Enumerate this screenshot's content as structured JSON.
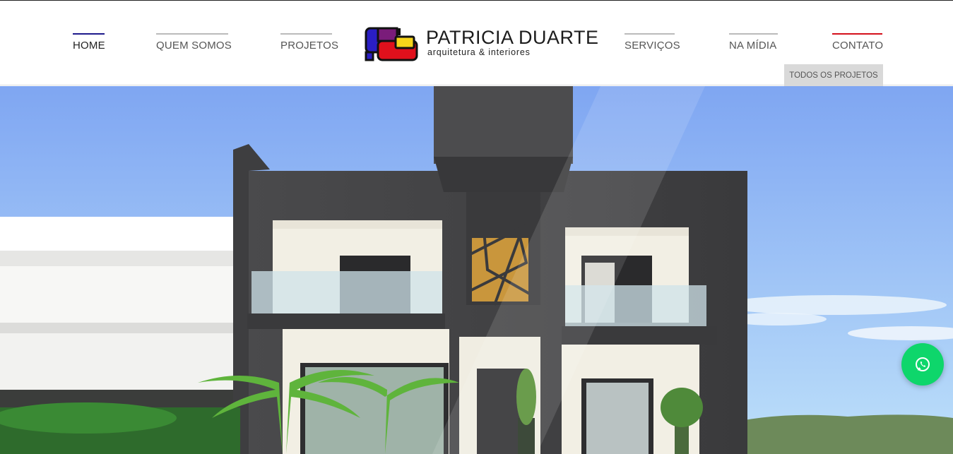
{
  "nav": {
    "left": [
      {
        "label": "HOME",
        "active": true,
        "bar_color": "#1e1a8c"
      },
      {
        "label": "QUEM SOMOS",
        "active": false,
        "bar_color": "#b5b5b5"
      },
      {
        "label": "PROJETOS",
        "active": false,
        "bar_color": "#b5b5b5"
      }
    ],
    "right": [
      {
        "label": "SERVIÇOS",
        "active": false,
        "bar_color": "#b5b5b5"
      },
      {
        "label": "NA MÍDIA",
        "active": false,
        "bar_color": "#b5b5b5"
      },
      {
        "label": "CONTATO",
        "active": false,
        "bar_color": "#d4101c"
      }
    ],
    "submenu_label": "TODOS OS PROJETOS"
  },
  "logo": {
    "name": "PATRICIA DUARTE",
    "subtitle": "arquitetura & interiores",
    "colors": {
      "blue": "#2a1ec4",
      "purple": "#7a1c7a",
      "red": "#e0101c",
      "yellow": "#f7d51a",
      "outline": "#111111"
    }
  },
  "hero": {
    "sky_top": "#7fa6f2",
    "sky_bottom": "#bde0fa"
  },
  "whatsapp": {
    "icon": "whatsapp-icon",
    "color": "#0ed66b"
  }
}
